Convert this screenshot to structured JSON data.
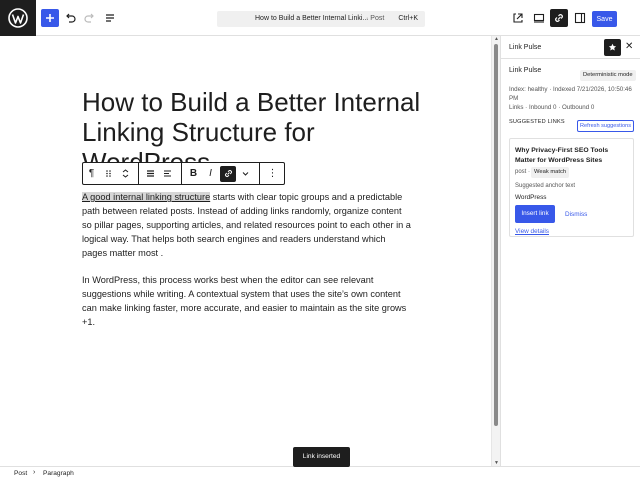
{
  "header": {
    "doc_title": "How to Build a Better Internal Linki...",
    "doc_type": "· Post",
    "shortcut": "Ctrl+K",
    "save_label": "Save",
    "icons": [
      "wordpress-logo-icon",
      "plus-icon",
      "undo-icon",
      "redo-icon",
      "list-view-icon",
      "external-view-icon",
      "desktop-preview-icon",
      "link-icon",
      "sidebar-toggle-icon"
    ]
  },
  "post": {
    "title": "How to Build a Better Internal Linking Structure for WordPress",
    "para1_highlight": "A good internal linking structure",
    "para1_rest": " starts with clear topic groups and a predictable path between related posts. Instead of adding links randomly, organize content so pillar pages, supporting articles, and related resources point to each other in a logical way. That helps both search engines and readers understand which pages matter most .",
    "para2": "In WordPress, this process works best when the editor can see relevant suggestions while writing. A contextual system that uses the site’s own content can make linking faster, more accurate, and easier to maintain as the site grows +1."
  },
  "block_toolbar": {
    "paragraph_glyph": "¶",
    "bold": "B",
    "italic": "I",
    "more": "⋮"
  },
  "sidebar": {
    "header_title": "Link Pulse",
    "label": "Link Pulse",
    "mode_badge": "Deterministic mode",
    "status": "Index: healthy · Indexed 7/21/2026, 10:50:46 PM",
    "links_stats": "Links · Inbound 0 · Outbound 0",
    "suggested_heading": "SUGGESTED LINKS",
    "refresh_label": "Refresh suggestions",
    "suggestion": {
      "title": "Why Privacy-First SEO Tools Matter for WordPress Sites",
      "type": "post ·",
      "match_badge": "Weak match",
      "anchor_label": "Suggested anchor text",
      "anchor_text": "WordPress",
      "insert_label": "Insert link",
      "dismiss_label": "Dismiss",
      "details_label": "View details"
    }
  },
  "footer": {
    "crumb1": "Post",
    "crumb2": "Paragraph"
  },
  "snackbar": {
    "message": "Link inserted"
  },
  "colors": {
    "accent": "#3858e9",
    "dark": "#1e1e1e"
  }
}
